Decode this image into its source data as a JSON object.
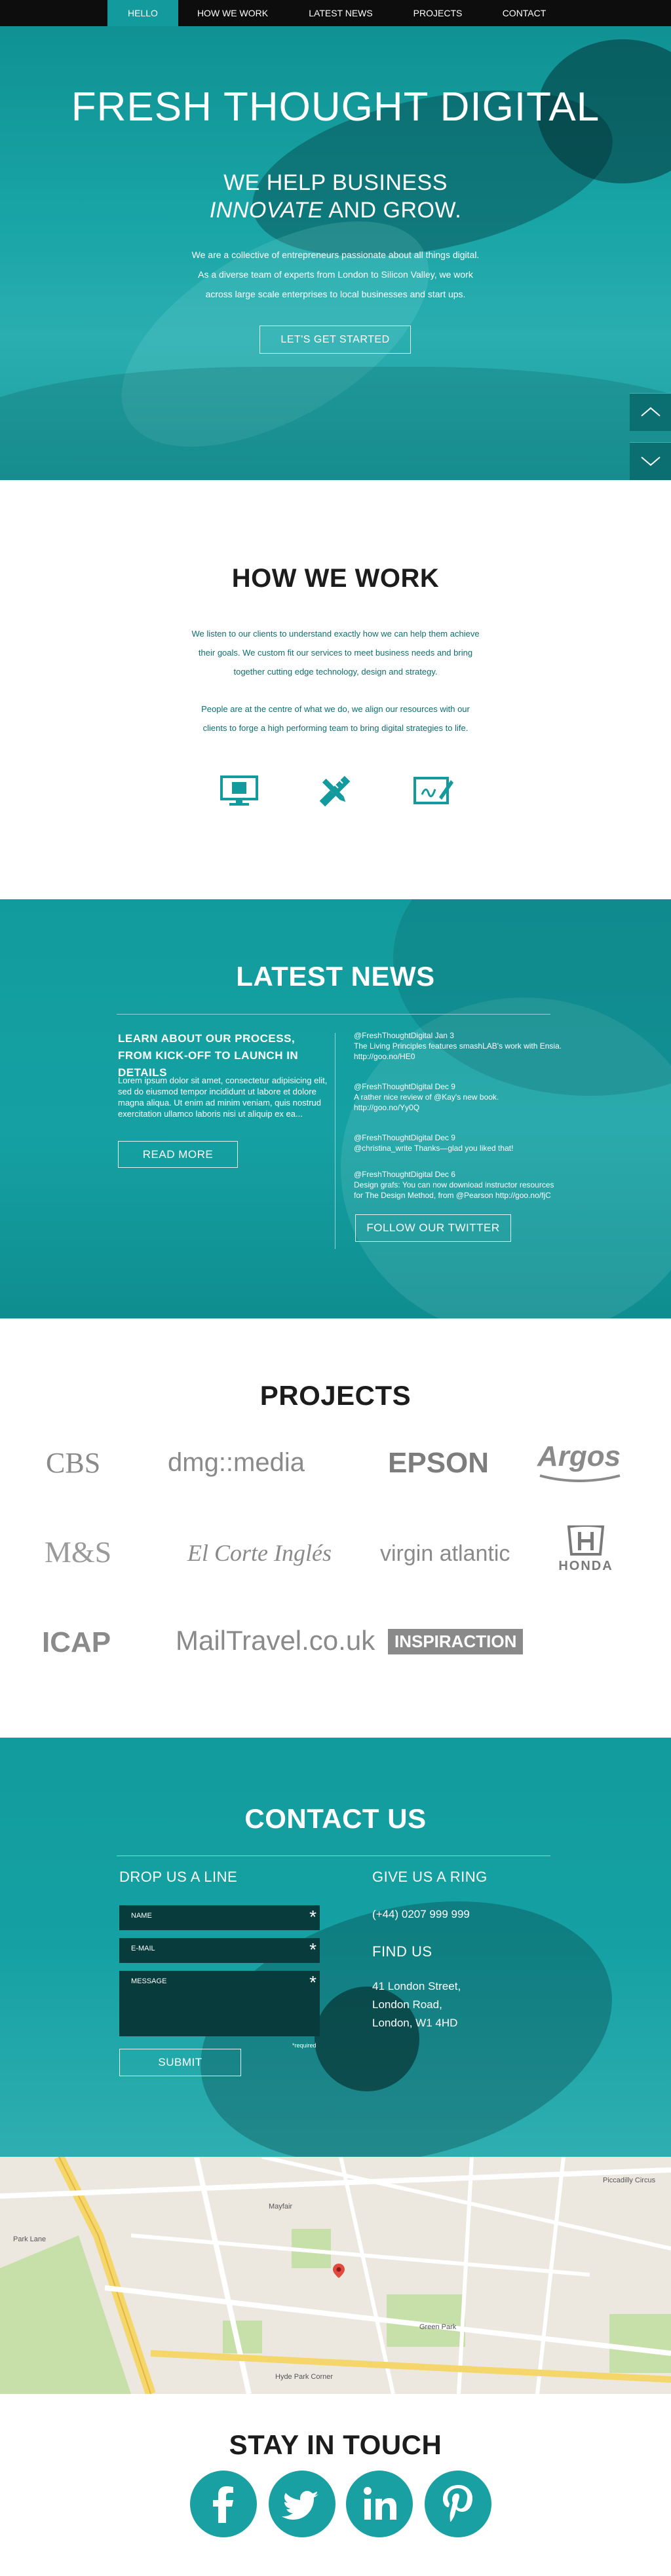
{
  "nav": {
    "items": [
      {
        "label": "HELLO",
        "active": true
      },
      {
        "label": "HOW WE WORK",
        "active": false
      },
      {
        "label": "LATEST NEWS",
        "active": false
      },
      {
        "label": "PROJECTS",
        "active": false
      },
      {
        "label": "CONTACT",
        "active": false
      }
    ]
  },
  "hero": {
    "title": "FRESH THOUGHT DIGITAL",
    "subtitle_line1": "WE HELP BUSINESS",
    "subtitle_line2_em": "INNOVATE",
    "subtitle_line2_rest": " AND GROW.",
    "paragraph": "We are a collective of entrepreneurs passionate about all things digital. As a diverse team of experts from London to Silicon Valley, we work across large scale enterprises to local businesses and start ups.",
    "cta": "LET'S GET STARTED"
  },
  "how": {
    "title": "HOW WE WORK",
    "paragraph1": "We listen to our clients to understand exactly how we can help them achieve their goals. We custom fit our services to meet business needs and bring together cutting edge technology, design and strategy.",
    "paragraph2": "People are at the centre of what we do, we align our resources with our clients to forge a high performing team to bring digital strategies to life.",
    "icons": [
      "monitor-icon",
      "pencil-ruler-icon",
      "sketch-board-icon"
    ]
  },
  "news": {
    "title": "LATEST NEWS",
    "heading": "LEARN ABOUT OUR PROCESS, FROM KICK-OFF TO LAUNCH IN DETAILS",
    "lorem": "Lorem ipsum dolor sit amet, consectetur adipisicing elit, sed do eiusmod tempor incididunt ut labore et dolore magna aliqua. Ut enim ad minim veniam, quis nostrud exercitation ullamco laboris nisi ut aliquip ex ea...",
    "read_more": "READ MORE",
    "tweets": [
      {
        "head": "@FreshThoughtDigital Jan 3",
        "body": "The Living Principles features smashLAB's work with Ensia. http://goo.no/HE0"
      },
      {
        "head": "@FreshThoughtDigital Dec 9",
        "body": "A rather nice review of @Kay's new book. http://goo.no/Yy0Q"
      },
      {
        "head": "@FreshThoughtDigital Dec 9",
        "body": "@christina_write Thanks—glad you liked that!"
      },
      {
        "head": "@FreshThoughtDigital Dec 6",
        "body": "Design grafs: You can now download instructor resources for The Design Method, from @Pearson http://goo.no/fjC"
      }
    ],
    "follow": "FOLLOW OUR TWITTER"
  },
  "projects": {
    "title": "PROJECTS",
    "logos": [
      "CBS",
      "dmg::media",
      "EPSON",
      "Argos",
      "M&S",
      "El Corte Inglés",
      "virgin atlantic",
      "HONDA",
      "ICAP",
      "MailTravel.co.uk",
      "INSPIRACTION"
    ]
  },
  "contact": {
    "title": "CONTACT US",
    "drop_heading": "DROP US A LINE",
    "name_placeholder": "NAME",
    "email_placeholder": "E-MAIL",
    "message_placeholder": "MESSAGE",
    "required_note": "*required",
    "submit": "SUBMIT",
    "ring_heading": "GIVE US A RING",
    "phone": "(+44) 0207 999 999",
    "find_heading": "FIND US",
    "address": [
      "41 London Street,",
      "London Road,",
      "London, W1 4HD"
    ]
  },
  "map": {
    "labels": [
      "Park Lane",
      "Green Park",
      "Piccadilly Circus",
      "Mayfair",
      "Hyde Park Corner"
    ]
  },
  "stay": {
    "title": "STAY IN TOUCH",
    "socials": [
      "facebook-icon",
      "twitter-icon",
      "linkedin-icon",
      "pinterest-icon"
    ]
  },
  "colors": {
    "teal": "#18a0a2",
    "dark_teal": "#073b3c",
    "nav_bg": "#0d0d0d"
  }
}
